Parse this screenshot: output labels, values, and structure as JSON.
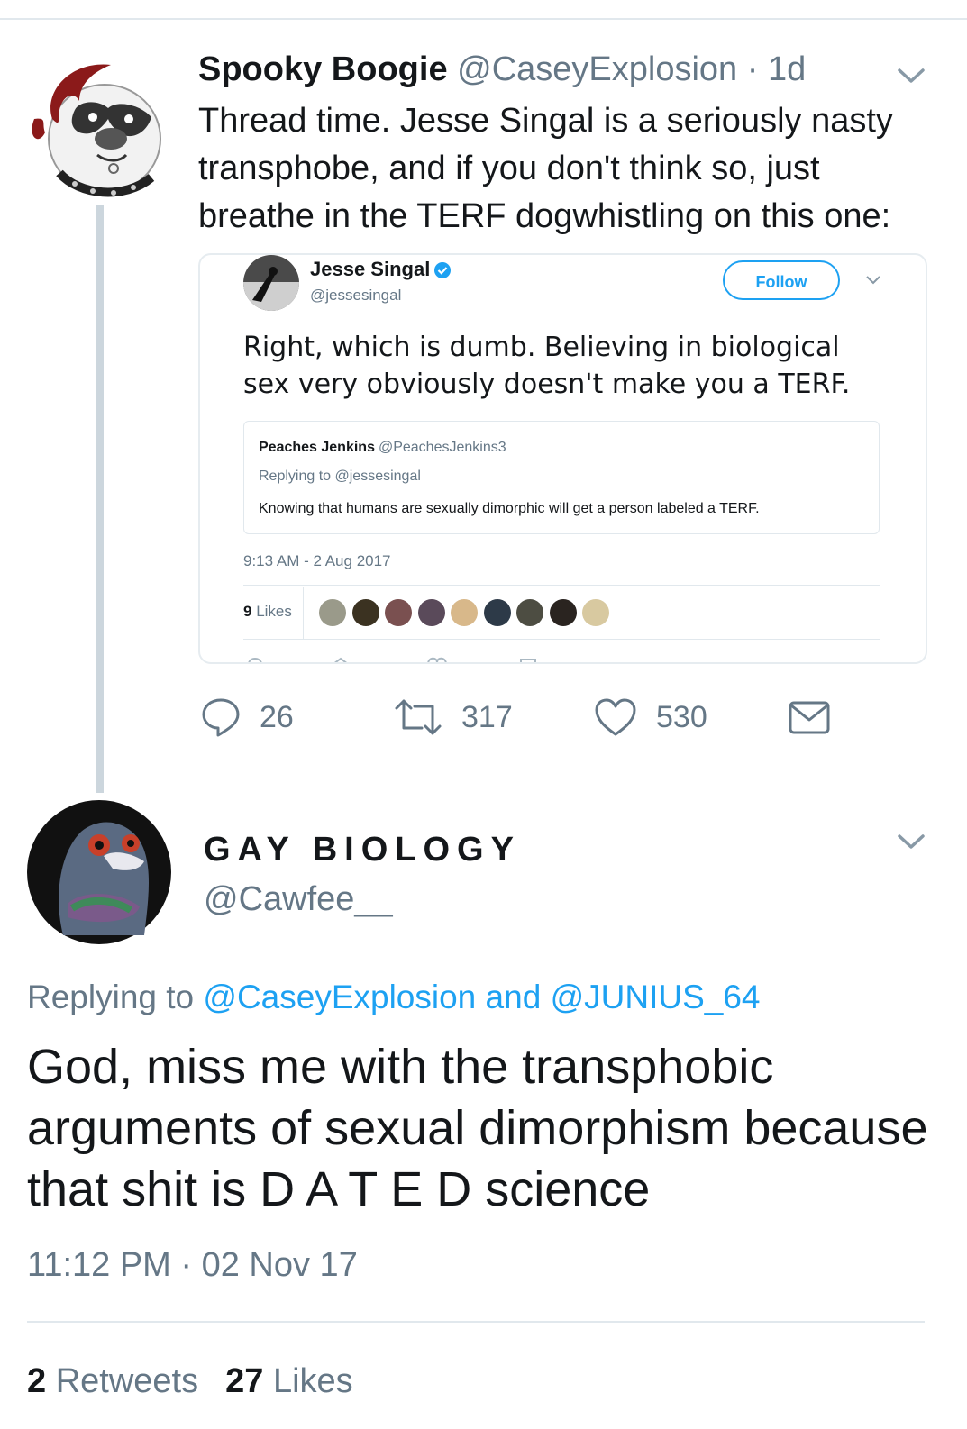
{
  "tweet1": {
    "display_name": "Spooky Boogie",
    "handle": "@CaseyExplosion",
    "separator": "·",
    "time": "1d",
    "text": "Thread time. Jesse Singal is a seriously nasty transphobe, and if you don't think so, just breathe in the TERF dogwhistling on this one:",
    "embedded": {
      "display_name": "Jesse Singal",
      "handle": "@jessesingal",
      "follow_label": "Follow",
      "text": "Right, which is dumb. Believing in biological sex very obviously doesn't make you a TERF.",
      "quoted": {
        "display_name": "Peaches Jenkins",
        "handle": "@PeachesJenkins3",
        "replying_to": "Replying to @jessesingal",
        "text": "Knowing that humans are sexually dimorphic will get a person labeled a TERF."
      },
      "timestamp": "9:13 AM - 2 Aug 2017",
      "likes_count": "9",
      "likes_label": "Likes"
    },
    "actions": {
      "replies": "26",
      "retweets": "317",
      "likes": "530"
    }
  },
  "tweet2": {
    "display_name": "GAY BIOLOGY",
    "handle": "@Cawfee__",
    "replying_prefix": "Replying to",
    "replying_user1": "@CaseyExplosion",
    "replying_and": "and",
    "replying_user2": "@JUNIUS_64",
    "text": "God, miss me with the transphobic arguments of sexual dimorphism because that shit is D A T E D science",
    "timestamp": "11:12 PM · 02 Nov 17",
    "retweets_count": "2",
    "retweets_label": "Retweets",
    "likes_count": "27",
    "likes_label": "Likes"
  },
  "colors": {
    "link": "#1da1f2",
    "secondary_text": "#657786",
    "primary_text": "#14171a",
    "divider": "#e1e8ed",
    "thread_line": "#ccd6dd"
  },
  "icons": [
    "reply-icon",
    "retweet-icon",
    "like-icon",
    "message-icon",
    "chevron-down-icon",
    "verified-icon"
  ]
}
